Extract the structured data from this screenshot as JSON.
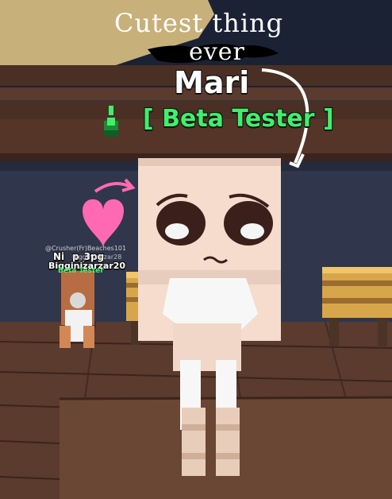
{
  "overlay": {
    "handwritten_line1": "Cutest thing",
    "handwritten_line2": "ever"
  },
  "player_main": {
    "name": "Mari",
    "title": "[ Beta Tester ]"
  },
  "player_bg": {
    "tag_top": "@Crusher(Fr)Beaches101",
    "tag_mid_1": "Ni",
    "tag_mid_2": "p_3pg",
    "tag_mid_3": "Bigginizarzar28",
    "name": "Bigginizarzar20",
    "title": "Beta Tester"
  },
  "colors": {
    "night_sky": "#1a2234",
    "wall_blue": "#2f3347",
    "wood_dark": "#4a2f24",
    "wood_mid": "#5b3b2d",
    "bench_yellow": "#d8a64a",
    "bench_shadow": "#9b6c2f",
    "beta_green": "#3ff06b",
    "beta_green_dark": "#1b8a35",
    "heart_pink": "#ff69b4",
    "skin": "#f5dccd",
    "skin_shadow": "#d9b9aa",
    "outfit_white": "#f7f7f7",
    "boots": "#e9cdbb"
  },
  "icons": {
    "beta_badge": "green-cube-badge-icon",
    "heart": "heart-icon",
    "arrow_big": "curved-arrow-icon",
    "arrow_pink": "curved-pink-arrow-icon"
  }
}
